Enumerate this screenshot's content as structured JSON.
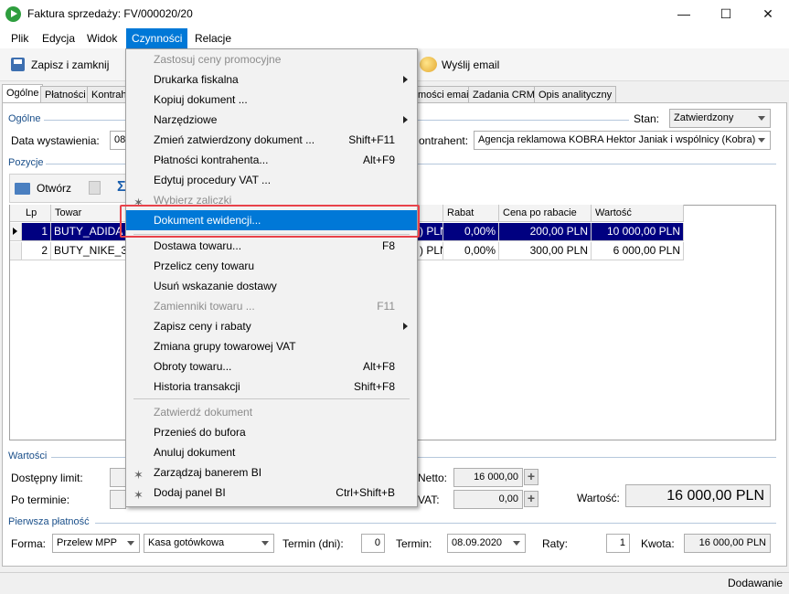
{
  "window": {
    "title": "Faktura sprzedaży: FV/000020/20",
    "minimize": "—",
    "maximize": "☐",
    "close": "✕"
  },
  "menubar": [
    "Plik",
    "Edycja",
    "Widok",
    "Czynności",
    "Relacje"
  ],
  "toolbar": {
    "save_close": "Zapisz i zamknij",
    "send_email": "Wyślij email"
  },
  "tabs": [
    "Ogólne",
    "Płatności",
    "Kontrah",
    "mości email",
    "Zadania CRM",
    "Opis analityczny"
  ],
  "general": {
    "group_title": "Ogólne",
    "issue_date_label": "Data wystawienia:",
    "issue_date_value": "08",
    "state_label": "Stan:",
    "state_value": "Zatwierdzony",
    "contractor_label": "ontrahent:",
    "contractor_value": "Agencja reklamowa KOBRA Hektor Janiak i wspólnicy (Kobra)"
  },
  "items": {
    "group_title": "Pozycje",
    "open_btn": "Otwórz",
    "columns": [
      "Lp",
      "Towar",
      "Rabat",
      "Cena po rabacie",
      "Wartość"
    ],
    "rows": [
      {
        "lp": "1",
        "towar": "BUTY_ADIDA",
        "cena_frag": ") PLN",
        "rabat": "0,00%",
        "cena_po": "200,00 PLN",
        "wartosc": "10 000,00 PLN"
      },
      {
        "lp": "2",
        "towar": "BUTY_NIKE_3",
        "cena_frag": ") PLN",
        "rabat": "0,00%",
        "cena_po": "300,00 PLN",
        "wartosc": "6 000,00 PLN"
      }
    ]
  },
  "values": {
    "group_title": "Wartości",
    "limit_label": "Dostępny limit:",
    "term_label": "Po terminie:",
    "netto_label": "Netto:",
    "netto_value": "16 000,00",
    "vat_label": "VAT:",
    "vat_value": "0,00",
    "total_label": "Wartość:",
    "total_value": "16 000,00 PLN"
  },
  "payment": {
    "group_title": "Pierwsza płatność",
    "form_label": "Forma:",
    "form_value": "Przelew MPP",
    "cash_value": "Kasa gotówkowa",
    "term_days_label": "Termin (dni):",
    "term_days_value": "0",
    "term_label": "Termin:",
    "term_value": "08.09.2020",
    "rates_label": "Raty:",
    "rates_value": "1",
    "amount_label": "Kwota:",
    "amount_value": "16 000,00 PLN"
  },
  "status": "Dodawanie",
  "menu": {
    "items": [
      {
        "label": "Zastosuj ceny promocyjne",
        "shortcut": "",
        "disabled": true,
        "submenu": false
      },
      {
        "label": "Drukarka fiskalna",
        "shortcut": "",
        "disabled": false,
        "submenu": true
      },
      {
        "label": "Kopiuj dokument ...",
        "shortcut": "",
        "disabled": false,
        "submenu": false
      },
      {
        "label": "Narzędziowe",
        "shortcut": "",
        "disabled": false,
        "submenu": true
      },
      {
        "label": "Zmień zatwierdzony dokument ...",
        "shortcut": "Shift+F11",
        "disabled": false,
        "submenu": false
      },
      {
        "label": "Płatności kontrahenta...",
        "shortcut": "Alt+F9",
        "disabled": false,
        "submenu": false
      },
      {
        "label": "Edytuj procedury VAT ...",
        "shortcut": "",
        "disabled": false,
        "submenu": false
      },
      {
        "label": "Wybierz zaliczki",
        "shortcut": "",
        "disabled": true,
        "submenu": false
      },
      {
        "label": "Dokument ewidencji...",
        "shortcut": "",
        "disabled": false,
        "submenu": false
      },
      {
        "label": "Dostawa towaru...",
        "shortcut": "F8",
        "disabled": false,
        "submenu": false
      },
      {
        "label": "Przelicz ceny towaru",
        "shortcut": "",
        "disabled": false,
        "submenu": false
      },
      {
        "label": "Usuń wskazanie dostawy",
        "shortcut": "",
        "disabled": false,
        "submenu": false
      },
      {
        "label": "Zamienniki towaru ...",
        "shortcut": "F11",
        "disabled": true,
        "submenu": false
      },
      {
        "label": "Zapisz ceny i rabaty",
        "shortcut": "",
        "disabled": false,
        "submenu": true
      },
      {
        "label": "Zmiana grupy towarowej VAT",
        "shortcut": "",
        "disabled": false,
        "submenu": false
      },
      {
        "label": "Obroty towaru...",
        "shortcut": "Alt+F8",
        "disabled": false,
        "submenu": false
      },
      {
        "label": "Historia transakcji",
        "shortcut": "Shift+F8",
        "disabled": false,
        "submenu": false
      },
      {
        "label": "Zatwierdź dokument",
        "shortcut": "",
        "disabled": true,
        "submenu": false
      },
      {
        "label": "Przenieś do bufora",
        "shortcut": "",
        "disabled": false,
        "submenu": false
      },
      {
        "label": "Anuluj dokument",
        "shortcut": "",
        "disabled": false,
        "submenu": false
      },
      {
        "label": "Zarządzaj banerem BI",
        "shortcut": "",
        "disabled": false,
        "submenu": false
      },
      {
        "label": "Dodaj panel BI",
        "shortcut": "Ctrl+Shift+B",
        "disabled": false,
        "submenu": false
      }
    ]
  },
  "colors": {
    "accent": "#0078d7",
    "selection": "#000080",
    "highlight_box": "#e8424a"
  }
}
